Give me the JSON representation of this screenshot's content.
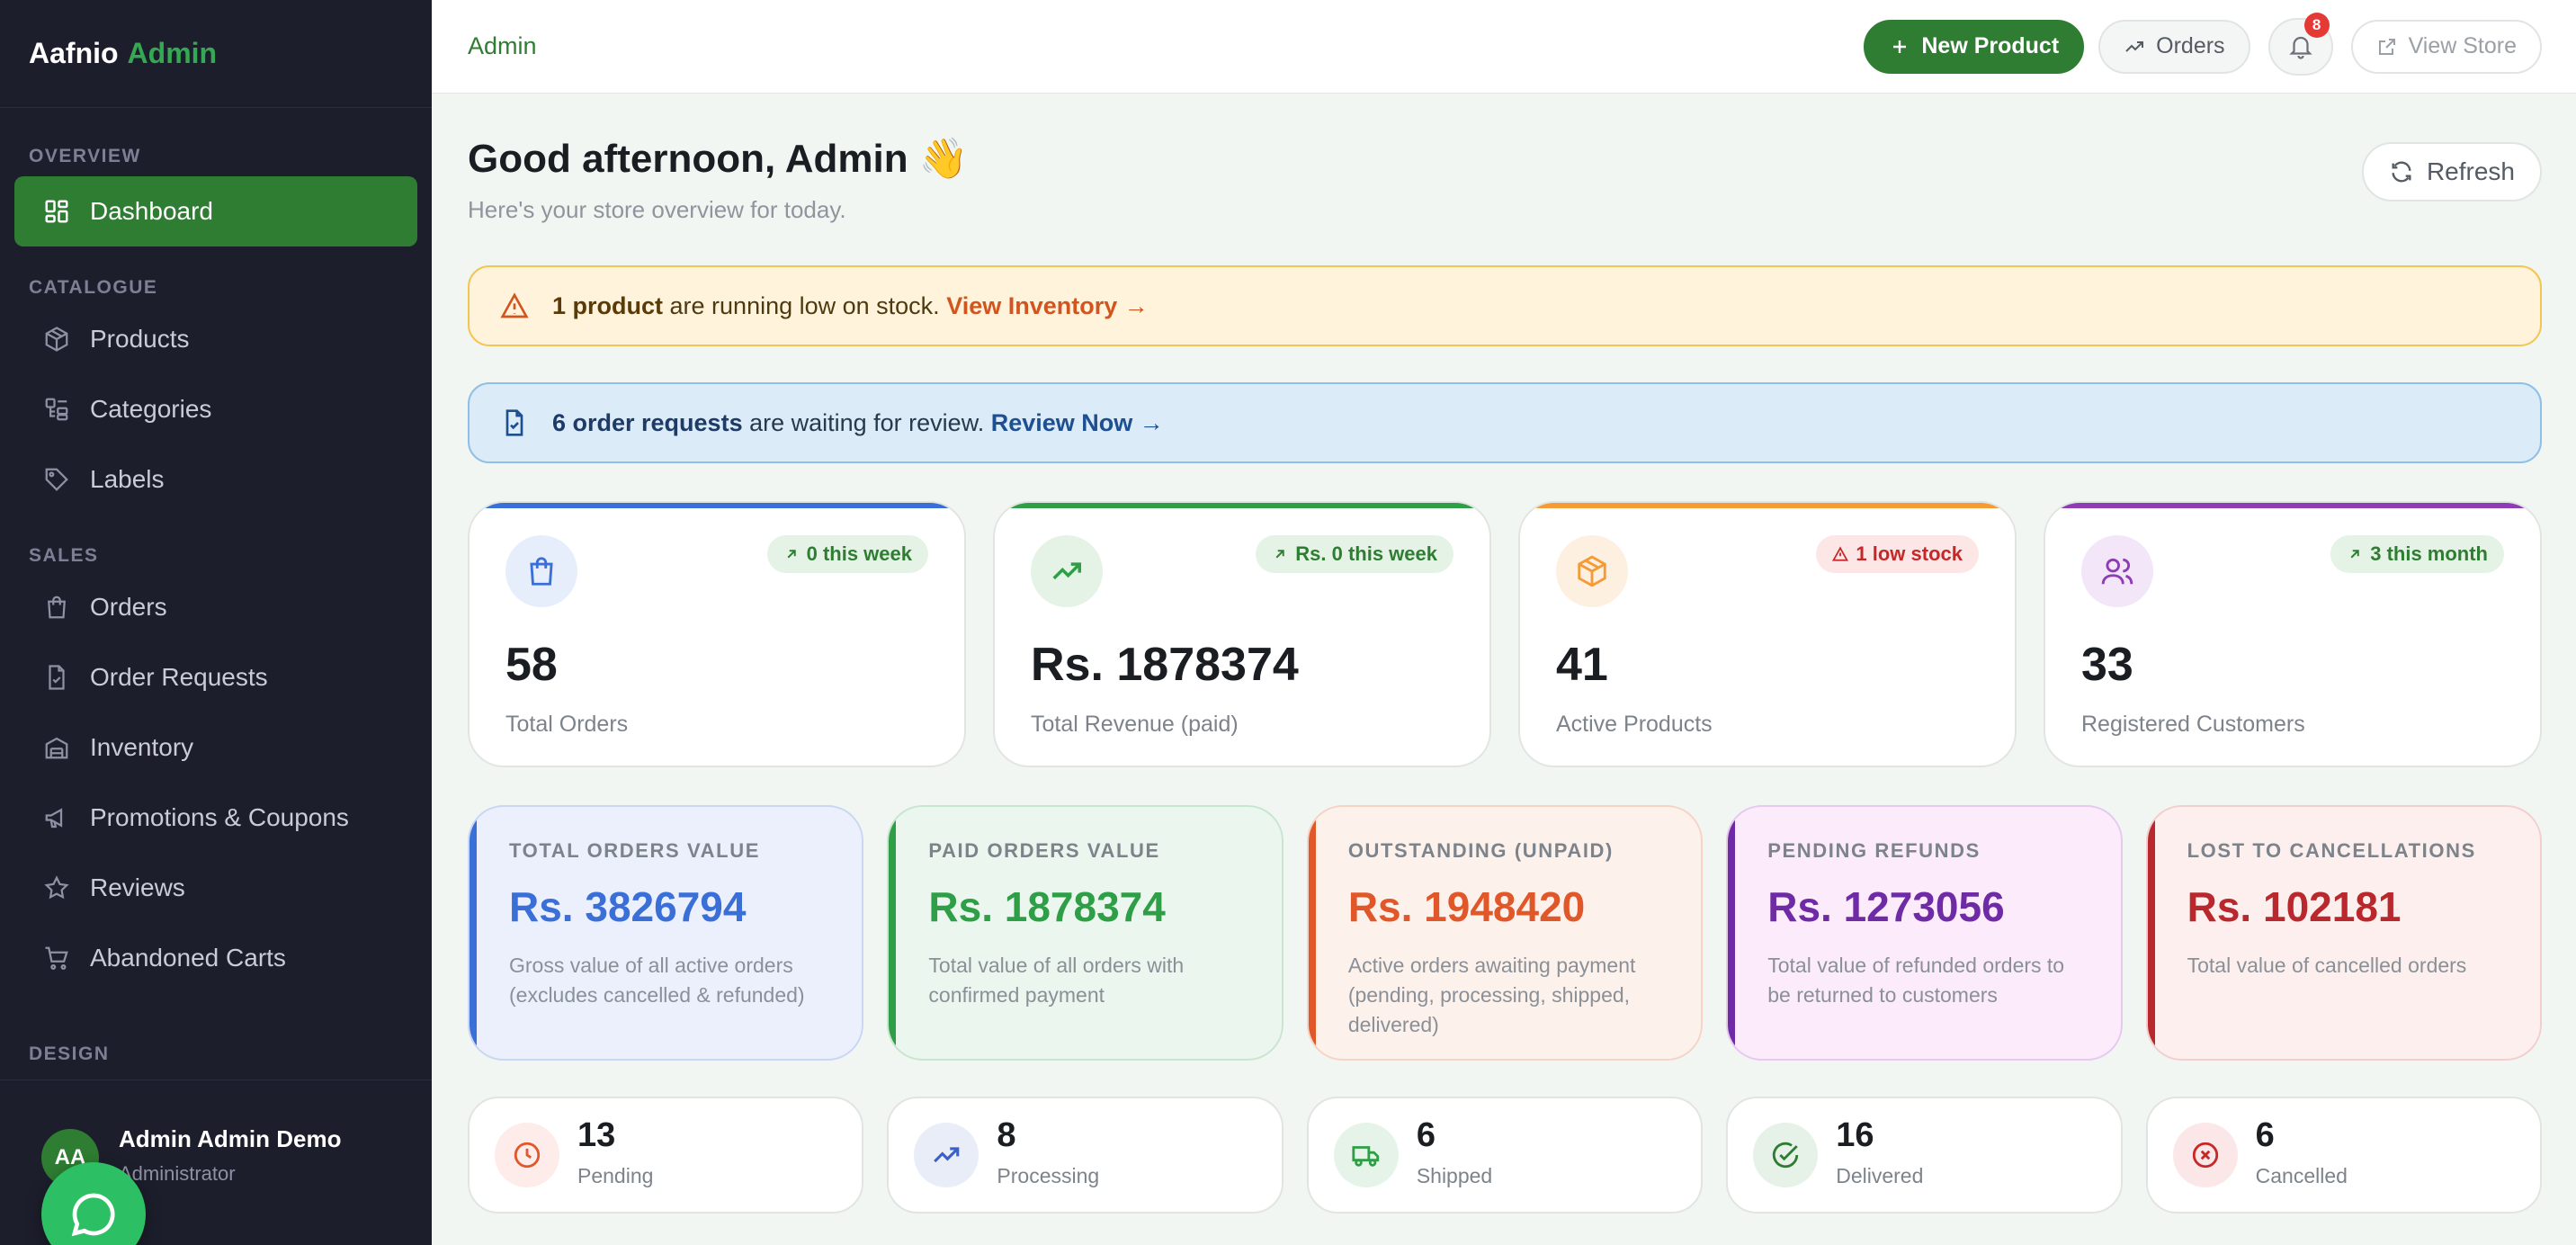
{
  "brand": {
    "name": "Aafnio",
    "accent": "Admin"
  },
  "sidebar": {
    "sections": [
      {
        "title": "OVERVIEW",
        "items": [
          {
            "label": "Dashboard",
            "icon": "dashboard-icon",
            "active": true
          }
        ]
      },
      {
        "title": "CATALOGUE",
        "items": [
          {
            "label": "Products",
            "icon": "box-icon"
          },
          {
            "label": "Categories",
            "icon": "categories-icon"
          },
          {
            "label": "Labels",
            "icon": "tag-icon"
          }
        ]
      },
      {
        "title": "SALES",
        "items": [
          {
            "label": "Orders",
            "icon": "shopping-bag-icon"
          },
          {
            "label": "Order Requests",
            "icon": "file-check-icon"
          },
          {
            "label": "Inventory",
            "icon": "warehouse-icon"
          },
          {
            "label": "Promotions & Coupons",
            "icon": "megaphone-icon"
          },
          {
            "label": "Reviews",
            "icon": "star-icon"
          },
          {
            "label": "Abandoned Carts",
            "icon": "cart-icon"
          }
        ]
      },
      {
        "title": "DESIGN",
        "items": []
      }
    ],
    "user": {
      "initials": "AA",
      "name": "Admin Admin Demo",
      "role": "Administrator"
    }
  },
  "topbar": {
    "breadcrumb": "Admin",
    "new_product": "New Product",
    "orders": "Orders",
    "notifications": "8",
    "view_store": "View Store"
  },
  "header": {
    "greeting": "Good afternoon, Admin 👋",
    "subtitle": "Here's your store overview for today.",
    "refresh": "Refresh"
  },
  "alerts": {
    "low_stock": {
      "bold": "1 product",
      "text": " are running low on stock. ",
      "link": "View Inventory →"
    },
    "order_requests": {
      "bold": "6 order requests",
      "text": " are waiting for review. ",
      "link": "Review Now →"
    }
  },
  "stats": [
    {
      "value": "58",
      "label": "Total Orders",
      "pill": "0 this week",
      "color": "#3b6fd8",
      "icon": "shopping-bag-icon"
    },
    {
      "value": "Rs. 1878374",
      "label": "Total Revenue (paid)",
      "pill": "Rs. 0 this week",
      "color": "#2e9e47",
      "icon": "trending-up-icon"
    },
    {
      "value": "41",
      "label": "Active Products",
      "pill": "1 low stock",
      "color": "#f59a35",
      "icon": "box-icon"
    },
    {
      "value": "33",
      "label": "Registered Customers",
      "pill": "3 this month",
      "color": "#8e3bb5",
      "icon": "users-icon"
    }
  ],
  "values": [
    {
      "title": "Total Orders Value",
      "amount": "Rs. 3826794",
      "desc": "Gross value of all active orders (excludes cancelled & refunded)",
      "color": "#3b6fd8"
    },
    {
      "title": "Paid Orders Value",
      "amount": "Rs. 1878374",
      "desc": "Total value of all orders with confirmed payment",
      "color": "#2e9e47"
    },
    {
      "title": "Outstanding (Unpaid)",
      "amount": "Rs. 1948420",
      "desc": "Active orders awaiting payment (pending, processing, shipped, delivered)",
      "color": "#e0572a"
    },
    {
      "title": "Pending Refunds",
      "amount": "Rs. 1273056",
      "desc": "Total value of refunded orders to be returned to customers",
      "color": "#6f2aa5"
    },
    {
      "title": "Lost to Cancellations",
      "amount": "Rs. 102181",
      "desc": "Total value of cancelled orders",
      "color": "#b8282c"
    }
  ],
  "statuses": [
    {
      "count": "13",
      "label": "Pending",
      "icon": "clock-icon",
      "color": "#e0572a"
    },
    {
      "count": "8",
      "label": "Processing",
      "icon": "trending-up-icon",
      "color": "#3b5fc8"
    },
    {
      "count": "6",
      "label": "Shipped",
      "icon": "truck-icon",
      "color": "#2e9e47"
    },
    {
      "count": "16",
      "label": "Delivered",
      "icon": "check-circle-icon",
      "color": "#2e7d32"
    },
    {
      "count": "6",
      "label": "Cancelled",
      "icon": "x-circle-icon",
      "color": "#c62828"
    }
  ]
}
